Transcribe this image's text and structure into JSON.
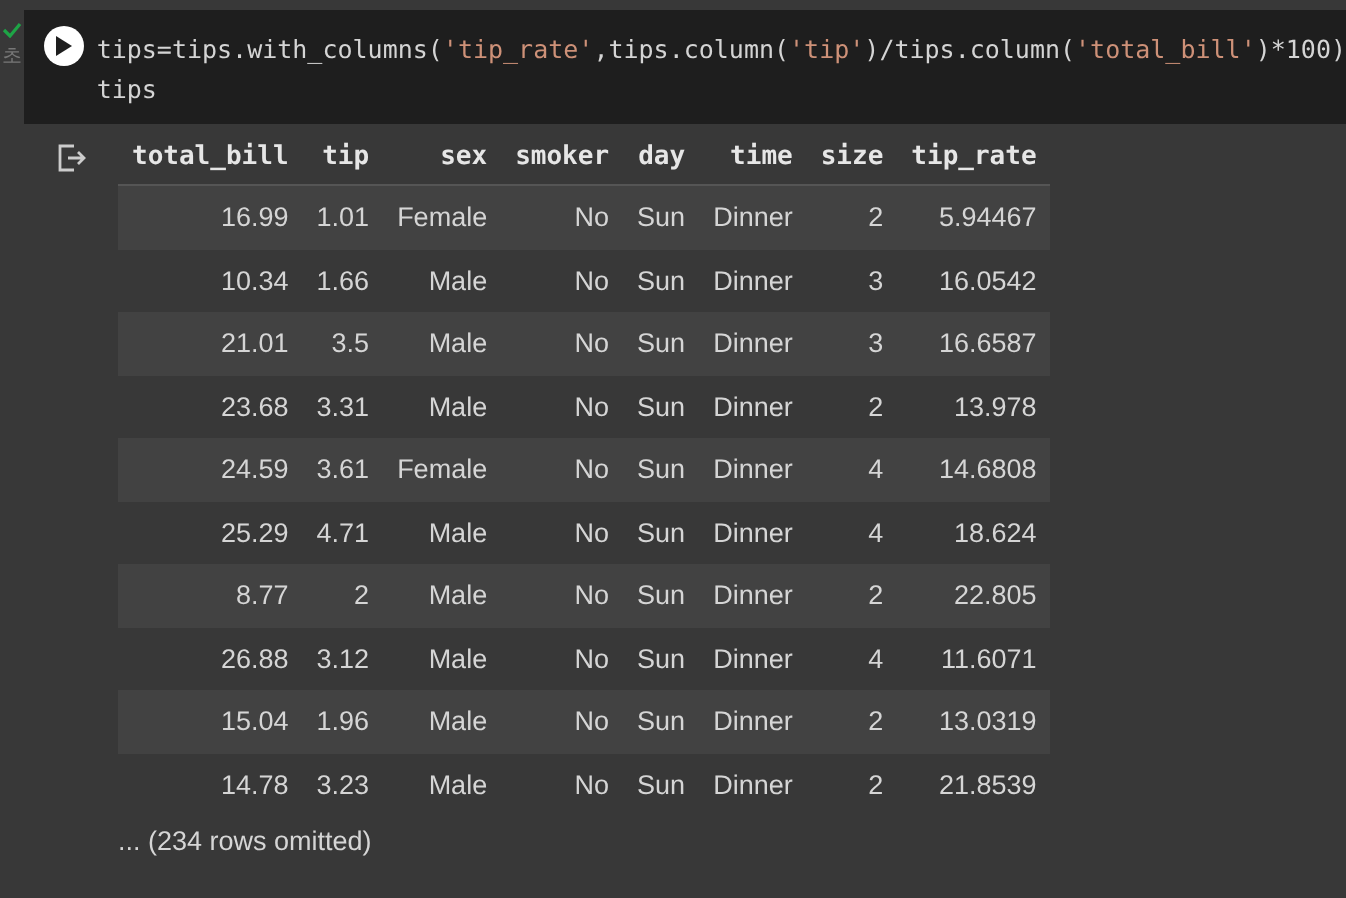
{
  "cell": {
    "status_text": "초",
    "code_lines": [
      [
        {
          "kind": "plain",
          "text": "tips=tips.with_columns("
        },
        {
          "kind": "string",
          "text": "'tip_rate'"
        },
        {
          "kind": "plain",
          "text": ",tips.column("
        },
        {
          "kind": "string",
          "text": "'tip'"
        },
        {
          "kind": "plain",
          "text": ")/tips.column("
        },
        {
          "kind": "string",
          "text": "'total_bill'"
        },
        {
          "kind": "plain",
          "text": ")*100)"
        }
      ],
      [
        {
          "kind": "plain",
          "text": "tips"
        }
      ]
    ]
  },
  "output": {
    "table": {
      "columns": [
        "total_bill",
        "tip",
        "sex",
        "smoker",
        "day",
        "time",
        "size",
        "tip_rate"
      ],
      "rows": [
        [
          "16.99",
          "1.01",
          "Female",
          "No",
          "Sun",
          "Dinner",
          "2",
          "5.94467"
        ],
        [
          "10.34",
          "1.66",
          "Male",
          "No",
          "Sun",
          "Dinner",
          "3",
          "16.0542"
        ],
        [
          "21.01",
          "3.5",
          "Male",
          "No",
          "Sun",
          "Dinner",
          "3",
          "16.6587"
        ],
        [
          "23.68",
          "3.31",
          "Male",
          "No",
          "Sun",
          "Dinner",
          "2",
          "13.978"
        ],
        [
          "24.59",
          "3.61",
          "Female",
          "No",
          "Sun",
          "Dinner",
          "4",
          "14.6808"
        ],
        [
          "25.29",
          "4.71",
          "Male",
          "No",
          "Sun",
          "Dinner",
          "4",
          "18.624"
        ],
        [
          "8.77",
          "2",
          "Male",
          "No",
          "Sun",
          "Dinner",
          "2",
          "22.805"
        ],
        [
          "26.88",
          "3.12",
          "Male",
          "No",
          "Sun",
          "Dinner",
          "4",
          "11.6071"
        ],
        [
          "15.04",
          "1.96",
          "Male",
          "No",
          "Sun",
          "Dinner",
          "2",
          "13.0319"
        ],
        [
          "14.78",
          "3.23",
          "Male",
          "No",
          "Sun",
          "Dinner",
          "2",
          "21.8539"
        ]
      ]
    },
    "footer": "... (234 rows omitted)"
  }
}
